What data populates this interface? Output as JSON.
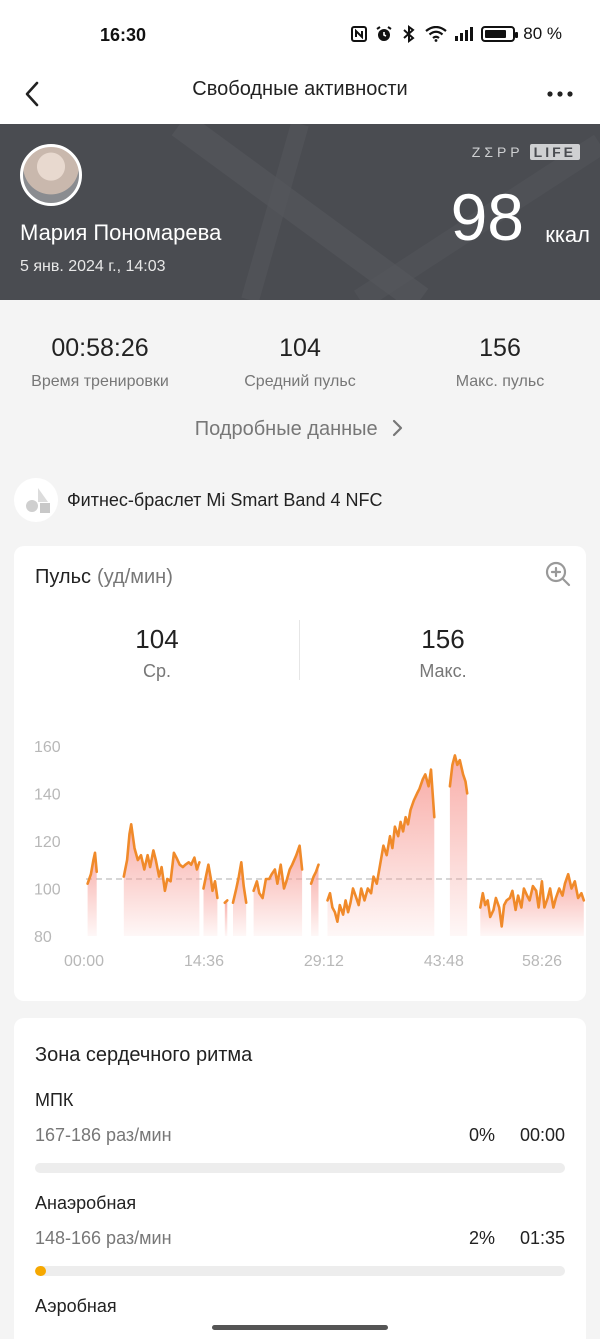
{
  "status_bar": {
    "time": "16:30",
    "battery_percent_label": "80 %",
    "battery_level": 0.8,
    "icons": [
      "nfc-icon",
      "alarm-icon",
      "bluetooth-icon",
      "wifi-icon",
      "cell-signal-icon",
      "battery-icon"
    ]
  },
  "nav": {
    "title": "Свободные активности",
    "back_icon": "chevron-left-icon",
    "more_icon": "more-dots-icon"
  },
  "hero": {
    "user_name": "Мария Пономарева",
    "date": "5 янв. 2024 г., 14:03",
    "brand_left": "ZΣPP",
    "brand_right": "LIFE",
    "calories_value": "98",
    "calories_unit": "ккал",
    "background_color": "#4a4c51"
  },
  "summary": {
    "stats": [
      {
        "value": "00:58:26",
        "label": "Время тренировки"
      },
      {
        "value": "104",
        "label": "Средний пульс"
      },
      {
        "value": "156",
        "label": "Макс. пульс"
      }
    ],
    "details_link": "Подробные данные"
  },
  "device": {
    "name": "Фитнес-браслет Mi Smart Band 4 NFC"
  },
  "heart_rate": {
    "title": "Пульс",
    "unit": "(уд/мин)",
    "avg_value": "104",
    "avg_label": "Ср.",
    "max_value": "156",
    "max_label": "Макс."
  },
  "chart_data": {
    "type": "area",
    "title": "",
    "xlabel": "",
    "ylabel": "",
    "ylim": [
      80,
      165
    ],
    "xlim": [
      0,
      58.43
    ],
    "x_unit": "minutes",
    "y_ticks": [
      "160",
      "140",
      "120",
      "100",
      "80"
    ],
    "y_tick_values": [
      160,
      140,
      120,
      100,
      80
    ],
    "x_ticks": [
      "00:00",
      "14:36",
      "29:12",
      "43:48",
      "58:26"
    ],
    "x_tick_values": [
      0,
      14.6,
      29.2,
      43.8,
      58.43
    ],
    "average_line": 104,
    "line_color": "#f08a2a",
    "fill_color": "#f7a09a",
    "segments": [
      [
        [
          0.2,
          102
        ],
        [
          0.6,
          106
        ],
        [
          0.9,
          112
        ],
        [
          1.1,
          115
        ],
        [
          1.3,
          107
        ]
      ],
      [
        [
          4.6,
          105
        ],
        [
          5.0,
          112
        ],
        [
          5.3,
          123
        ],
        [
          5.5,
          127
        ],
        [
          5.9,
          117
        ],
        [
          6.3,
          112
        ],
        [
          6.7,
          114
        ],
        [
          7.1,
          108
        ],
        [
          7.5,
          114
        ],
        [
          7.8,
          109
        ],
        [
          8.2,
          116
        ],
        [
          8.5,
          112
        ],
        [
          8.9,
          105
        ],
        [
          9.2,
          109
        ],
        [
          9.6,
          99
        ],
        [
          9.9,
          104
        ],
        [
          10.3,
          103
        ],
        [
          10.7,
          115
        ],
        [
          11.0,
          113
        ],
        [
          11.4,
          110
        ],
        [
          11.8,
          109
        ],
        [
          12.1,
          110
        ],
        [
          12.5,
          111
        ],
        [
          12.8,
          110
        ],
        [
          13.2,
          113
        ],
        [
          13.5,
          108
        ],
        [
          13.8,
          111
        ]
      ],
      [
        [
          14.3,
          100
        ],
        [
          14.6,
          105
        ],
        [
          14.9,
          110
        ],
        [
          15.2,
          104
        ],
        [
          15.4,
          99
        ],
        [
          15.7,
          103
        ],
        [
          16.0,
          96
        ]
      ],
      [
        [
          16.9,
          94
        ],
        [
          17.2,
          95
        ]
      ],
      [
        [
          17.9,
          94
        ],
        [
          18.3,
          100
        ],
        [
          18.6,
          105
        ],
        [
          18.9,
          111
        ],
        [
          19.2,
          101
        ],
        [
          19.5,
          94
        ]
      ],
      [
        [
          20.4,
          99
        ],
        [
          20.8,
          103
        ],
        [
          21.1,
          98
        ],
        [
          21.5,
          96
        ],
        [
          21.9,
          104
        ],
        [
          22.3,
          104
        ],
        [
          22.6,
          106
        ],
        [
          23.0,
          108
        ],
        [
          23.3,
          102
        ],
        [
          23.7,
          110
        ],
        [
          24.1,
          100
        ],
        [
          24.4,
          103
        ],
        [
          24.8,
          108
        ],
        [
          25.1,
          110
        ],
        [
          25.6,
          114
        ],
        [
          26.0,
          118
        ],
        [
          26.3,
          108
        ]
      ],
      [
        [
          27.4,
          102
        ],
        [
          27.7,
          105
        ],
        [
          28.0,
          107
        ],
        [
          28.3,
          110
        ]
      ],
      [
        [
          29.4,
          95
        ],
        [
          29.7,
          98
        ],
        [
          30.0,
          92
        ],
        [
          30.3,
          90
        ],
        [
          30.6,
          86
        ],
        [
          30.9,
          93
        ],
        [
          31.3,
          89
        ],
        [
          31.6,
          95
        ],
        [
          31.9,
          90
        ],
        [
          32.2,
          94
        ],
        [
          32.5,
          100
        ],
        [
          32.8,
          97
        ],
        [
          33.2,
          93
        ],
        [
          33.5,
          100
        ],
        [
          33.9,
          95
        ],
        [
          34.3,
          100
        ],
        [
          34.7,
          98
        ],
        [
          35.0,
          105
        ],
        [
          35.4,
          102
        ],
        [
          35.8,
          110
        ],
        [
          36.2,
          118
        ],
        [
          36.6,
          114
        ],
        [
          37.0,
          122
        ],
        [
          37.3,
          117
        ],
        [
          37.6,
          126
        ],
        [
          38.0,
          122
        ],
        [
          38.3,
          128
        ],
        [
          38.6,
          124
        ],
        [
          38.9,
          130
        ],
        [
          39.2,
          127
        ],
        [
          39.5,
          133
        ],
        [
          39.9,
          137
        ],
        [
          40.3,
          140
        ],
        [
          40.6,
          142
        ],
        [
          41.0,
          146
        ],
        [
          41.3,
          148
        ],
        [
          41.7,
          143
        ],
        [
          42.0,
          150
        ],
        [
          42.4,
          130
        ]
      ],
      [
        [
          44.3,
          143
        ],
        [
          44.6,
          152
        ],
        [
          44.9,
          156
        ],
        [
          45.2,
          152
        ],
        [
          45.5,
          154
        ],
        [
          45.9,
          148
        ],
        [
          46.2,
          145
        ],
        [
          46.4,
          140
        ]
      ],
      [
        [
          48.0,
          92
        ],
        [
          48.3,
          98
        ],
        [
          48.6,
          93
        ],
        [
          48.9,
          95
        ],
        [
          49.2,
          88
        ],
        [
          49.6,
          91
        ],
        [
          49.9,
          96
        ],
        [
          50.3,
          92
        ],
        [
          50.6,
          84
        ],
        [
          50.9,
          93
        ],
        [
          51.2,
          95
        ],
        [
          51.6,
          96
        ],
        [
          51.9,
          99
        ],
        [
          52.3,
          91
        ],
        [
          52.6,
          97
        ],
        [
          53.0,
          92
        ],
        [
          53.3,
          100
        ],
        [
          53.7,
          97
        ],
        [
          54.0,
          95
        ],
        [
          54.4,
          101
        ],
        [
          54.8,
          99
        ],
        [
          55.1,
          92
        ],
        [
          55.5,
          103
        ],
        [
          55.8,
          92
        ],
        [
          56.2,
          96
        ],
        [
          56.5,
          100
        ],
        [
          56.9,
          92
        ],
        [
          57.2,
          96
        ],
        [
          57.6,
          100
        ],
        [
          58.0,
          97
        ],
        [
          58.3,
          102
        ],
        [
          58.7,
          106
        ],
        [
          59.1,
          100
        ],
        [
          59.5,
          103
        ],
        [
          59.9,
          96
        ],
        [
          60.3,
          98
        ],
        [
          60.6,
          95
        ]
      ]
    ]
  },
  "zones": {
    "title": "Зона сердечного ритма",
    "items": [
      {
        "name": "МПК",
        "range": "167-186 раз/мин",
        "percent": "0%",
        "time": "00:00",
        "fraction": 0.0
      },
      {
        "name": "Анаэробная",
        "range": "148-166 раз/мин",
        "percent": "2%",
        "time": "01:35",
        "fraction": 0.02
      },
      {
        "name": "Аэробная",
        "range": "",
        "percent": "",
        "time": "",
        "fraction": 0.0
      }
    ]
  }
}
